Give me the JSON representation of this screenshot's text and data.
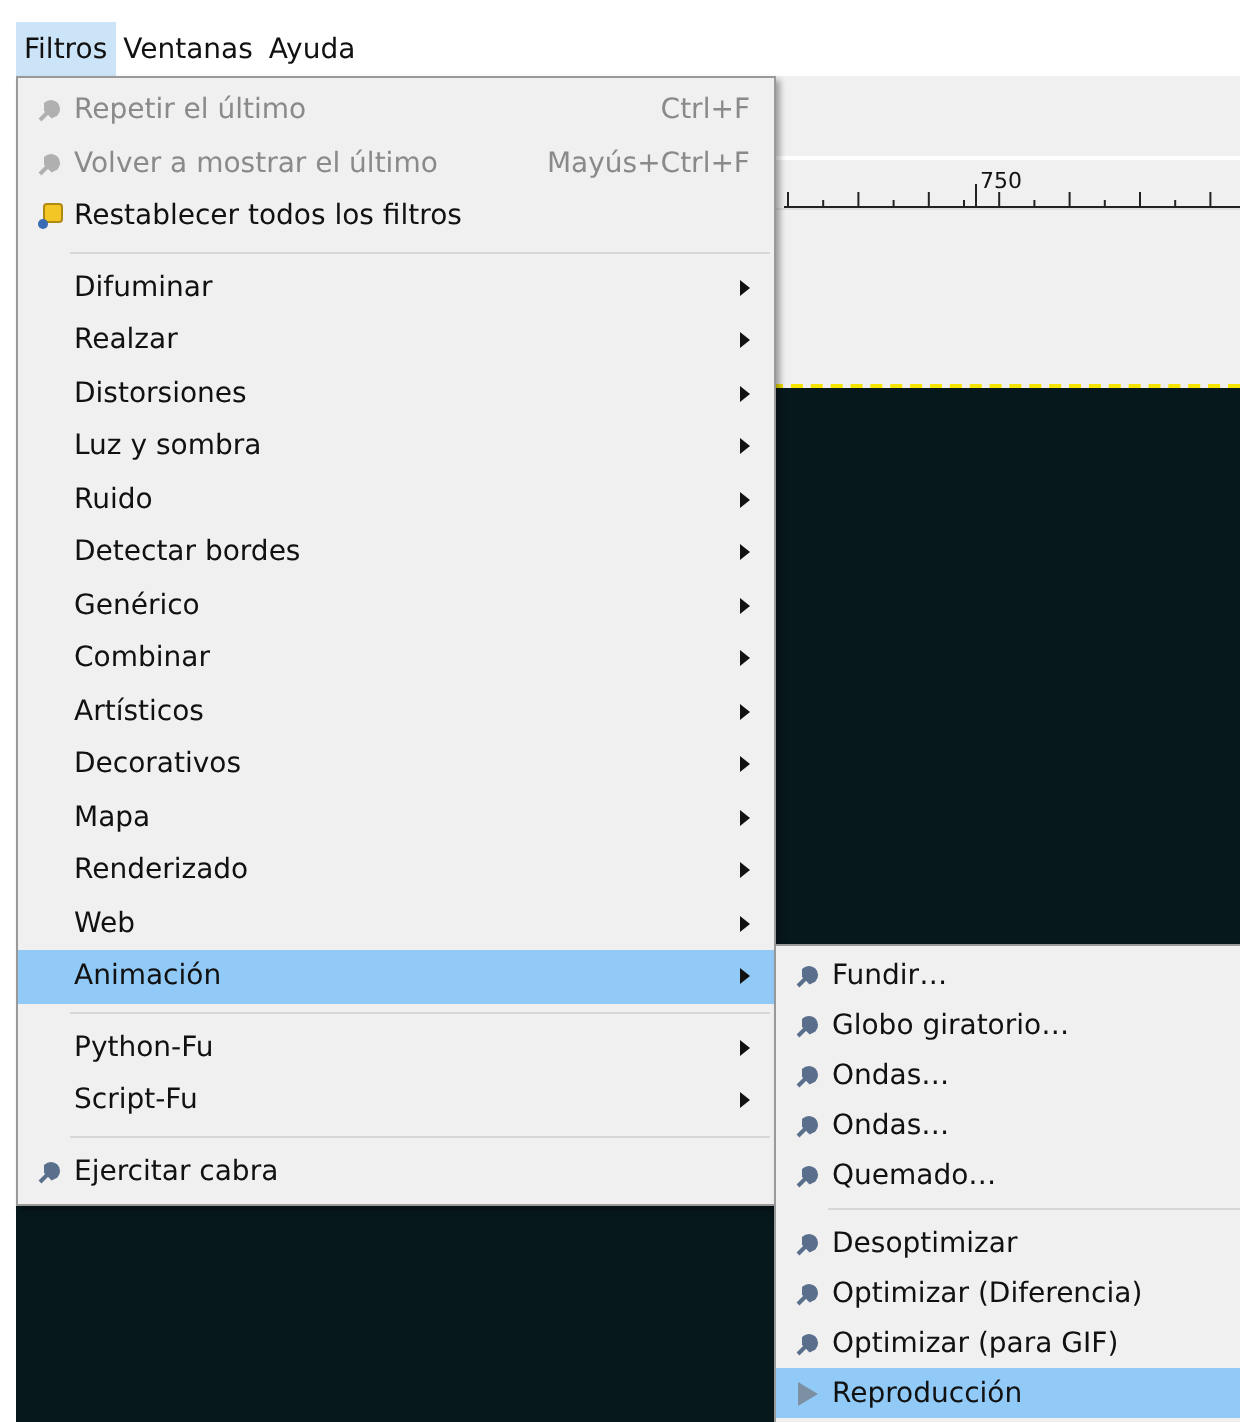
{
  "menubar": [
    {
      "label": "Filtros",
      "selected": true
    },
    {
      "label": "Ventanas",
      "selected": false
    },
    {
      "label": "Ayuda",
      "selected": false
    }
  ],
  "ruler": {
    "label": "750"
  },
  "menu": [
    {
      "kind": "plugin",
      "label": "Repetir el último",
      "shortcut": "Ctrl+F",
      "disabled": true,
      "submenu": false,
      "selected": false
    },
    {
      "kind": "plugin",
      "label": "Volver a mostrar el último",
      "shortcut": "Mayús+Ctrl+F",
      "disabled": true,
      "submenu": false,
      "selected": false
    },
    {
      "kind": "reset",
      "label": "Restablecer todos los filtros",
      "disabled": false,
      "submenu": false,
      "selected": false
    },
    {
      "kind": "separator"
    },
    {
      "kind": "plain",
      "label": "Difuminar",
      "disabled": false,
      "submenu": true,
      "selected": false
    },
    {
      "kind": "plain",
      "label": "Realzar",
      "disabled": false,
      "submenu": true,
      "selected": false
    },
    {
      "kind": "plain",
      "label": "Distorsiones",
      "disabled": false,
      "submenu": true,
      "selected": false
    },
    {
      "kind": "plain",
      "label": "Luz y sombra",
      "disabled": false,
      "submenu": true,
      "selected": false
    },
    {
      "kind": "plain",
      "label": "Ruido",
      "disabled": false,
      "submenu": true,
      "selected": false
    },
    {
      "kind": "plain",
      "label": "Detectar bordes",
      "disabled": false,
      "submenu": true,
      "selected": false
    },
    {
      "kind": "plain",
      "label": "Genérico",
      "disabled": false,
      "submenu": true,
      "selected": false
    },
    {
      "kind": "plain",
      "label": "Combinar",
      "disabled": false,
      "submenu": true,
      "selected": false
    },
    {
      "kind": "plain",
      "label": "Artísticos",
      "disabled": false,
      "submenu": true,
      "selected": false
    },
    {
      "kind": "plain",
      "label": "Decorativos",
      "disabled": false,
      "submenu": true,
      "selected": false
    },
    {
      "kind": "plain",
      "label": "Mapa",
      "disabled": false,
      "submenu": true,
      "selected": false
    },
    {
      "kind": "plain",
      "label": "Renderizado",
      "disabled": false,
      "submenu": true,
      "selected": false
    },
    {
      "kind": "plain",
      "label": "Web",
      "disabled": false,
      "submenu": true,
      "selected": false
    },
    {
      "kind": "plain",
      "label": "Animación",
      "disabled": false,
      "submenu": true,
      "selected": true
    },
    {
      "kind": "separator"
    },
    {
      "kind": "plain",
      "label": "Python-Fu",
      "disabled": false,
      "submenu": true,
      "selected": false
    },
    {
      "kind": "plain",
      "label": "Script-Fu",
      "disabled": false,
      "submenu": true,
      "selected": false
    },
    {
      "kind": "separator"
    },
    {
      "kind": "plugin",
      "label": "Ejercitar cabra",
      "disabled": false,
      "submenu": false,
      "selected": false
    }
  ],
  "submenu": [
    {
      "kind": "plugin",
      "label": "Fundir…",
      "selected": false
    },
    {
      "kind": "plugin",
      "label": "Globo giratorio…",
      "selected": false
    },
    {
      "kind": "plugin",
      "label": "Ondas…",
      "selected": false
    },
    {
      "kind": "plugin",
      "label": "Ondas…",
      "selected": false
    },
    {
      "kind": "plugin",
      "label": "Quemado…",
      "selected": false
    },
    {
      "kind": "separator"
    },
    {
      "kind": "plugin",
      "label": "Desoptimizar",
      "selected": false
    },
    {
      "kind": "plugin",
      "label": "Optimizar (Diferencia)",
      "selected": false
    },
    {
      "kind": "plugin",
      "label": "Optimizar (para GIF)",
      "selected": false
    },
    {
      "kind": "play",
      "label": "Reproducción",
      "selected": true
    }
  ]
}
